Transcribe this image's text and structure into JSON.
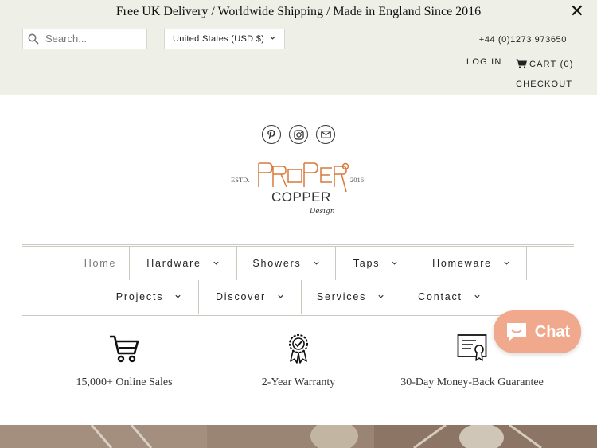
{
  "announcement": {
    "text": "Free UK Delivery / Worldwide Shipping / Made in England Since 2016",
    "close_icon": "close-icon"
  },
  "search": {
    "placeholder": "Search..."
  },
  "currency": {
    "selected": "United States (USD $)"
  },
  "contact": {
    "phone": "+44 (0)1273 973650"
  },
  "account": {
    "login_label": "LOG IN",
    "cart_label": "CART (0)",
    "checkout_label": "CHECKOUT"
  },
  "socials": [
    "pinterest-icon",
    "instagram-icon",
    "email-icon"
  ],
  "logo": {
    "left_text": "ESTD.",
    "right_text": "2016",
    "wordmark": "PROPER",
    "sub": "COPPER",
    "tag": "Design"
  },
  "nav": {
    "row1": [
      {
        "label": "Home"
      },
      {
        "label": "Hardware"
      },
      {
        "label": "Showers"
      },
      {
        "label": "Taps"
      },
      {
        "label": "Homeware"
      }
    ],
    "row2": [
      {
        "label": "Projects"
      },
      {
        "label": "Discover"
      },
      {
        "label": "Services"
      },
      {
        "label": "Contact"
      }
    ]
  },
  "features": [
    {
      "icon": "cart-icon",
      "label": "15,000+ Online Sales"
    },
    {
      "icon": "award-ribbon-icon",
      "label": "2-Year Warranty"
    },
    {
      "icon": "certificate-icon",
      "label": "30-Day Money-Back Guarantee"
    }
  ],
  "chat": {
    "label": "Chat",
    "color": "#f1a98e"
  },
  "colors": {
    "topbar_bg": "#eef0e8",
    "logo_orange": "#d9783a"
  }
}
